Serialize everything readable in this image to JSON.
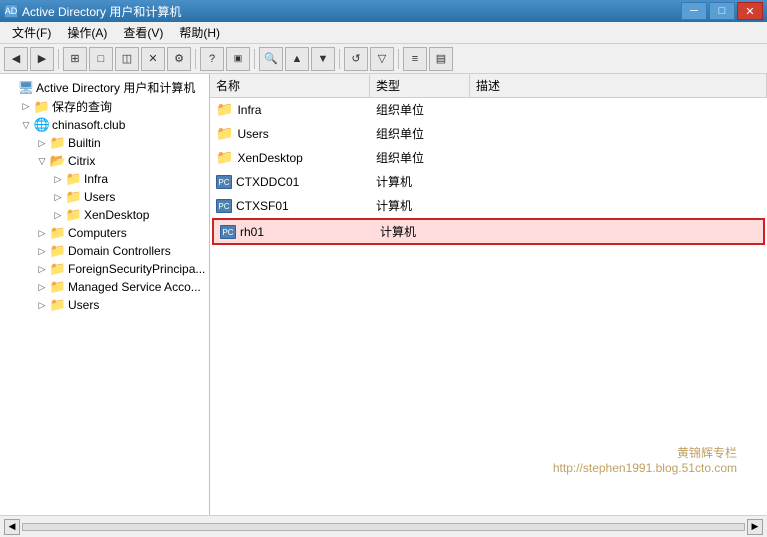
{
  "titleBar": {
    "title": "Active Directory 用户和计算机",
    "minBtn": "─",
    "maxBtn": "□",
    "closeBtn": "✕",
    "iconLabel": "AD"
  },
  "menuBar": {
    "items": [
      {
        "label": "文件(F)"
      },
      {
        "label": "操作(A)"
      },
      {
        "label": "查看(V)"
      },
      {
        "label": "帮助(H)"
      }
    ]
  },
  "toolbar": {
    "buttons": [
      {
        "label": "◀",
        "name": "back-btn"
      },
      {
        "label": "▶",
        "name": "forward-btn"
      },
      {
        "label": "↑",
        "name": "up-btn"
      },
      {
        "label": "⊞",
        "name": "view-btn"
      },
      {
        "label": "□",
        "name": "copy-btn"
      },
      {
        "label": "◫",
        "name": "paste-btn"
      },
      {
        "label": "✕",
        "name": "delete-btn"
      },
      {
        "label": "⚙",
        "name": "prop-btn"
      },
      {
        "sep": true
      },
      {
        "label": "?",
        "name": "help-btn"
      },
      {
        "label": "▣",
        "name": "domain-btn"
      },
      {
        "sep": true
      },
      {
        "label": "🔍",
        "name": "search-btn"
      },
      {
        "label": "▲",
        "name": "move-up-btn"
      },
      {
        "label": "▼",
        "name": "move-down-btn"
      },
      {
        "sep": true
      },
      {
        "label": "🔃",
        "name": "refresh-btn"
      },
      {
        "label": "≡",
        "name": "filter-btn"
      },
      {
        "sep": true
      },
      {
        "label": "▤",
        "name": "list1-btn"
      },
      {
        "label": "◫",
        "name": "list2-btn"
      }
    ]
  },
  "tree": {
    "items": [
      {
        "id": "root",
        "label": "Active Directory 用户和计算机",
        "indent": 0,
        "type": "root",
        "expanded": true,
        "toggle": ""
      },
      {
        "id": "saved",
        "label": "保存的查询",
        "indent": 1,
        "type": "folder",
        "expanded": false,
        "toggle": "▷"
      },
      {
        "id": "domain",
        "label": "chinasoft.club",
        "indent": 1,
        "type": "domain",
        "expanded": true,
        "toggle": "▽"
      },
      {
        "id": "builtin",
        "label": "Builtin",
        "indent": 2,
        "type": "folder",
        "expanded": false,
        "toggle": "▷"
      },
      {
        "id": "citrix",
        "label": "Citrix",
        "indent": 2,
        "type": "folder",
        "expanded": true,
        "toggle": "▽"
      },
      {
        "id": "infra",
        "label": "Infra",
        "indent": 3,
        "type": "ou",
        "expanded": false,
        "toggle": "▷"
      },
      {
        "id": "users",
        "label": "Users",
        "indent": 3,
        "type": "ou",
        "expanded": false,
        "toggle": "▷"
      },
      {
        "id": "xendesktop",
        "label": "XenDesktop",
        "indent": 3,
        "type": "ou",
        "expanded": false,
        "toggle": "▷"
      },
      {
        "id": "computers",
        "label": "Computers",
        "indent": 2,
        "type": "folder",
        "expanded": false,
        "toggle": "▷",
        "selected": false
      },
      {
        "id": "domainControllers",
        "label": "Domain Controllers",
        "indent": 2,
        "type": "folder",
        "expanded": false,
        "toggle": "▷"
      },
      {
        "id": "foreignSecurity",
        "label": "ForeignSecurityPrincipa...",
        "indent": 2,
        "type": "folder",
        "expanded": false,
        "toggle": "▷"
      },
      {
        "id": "managedService",
        "label": "Managed Service Acco...",
        "indent": 2,
        "type": "folder",
        "expanded": false,
        "toggle": "▷"
      },
      {
        "id": "usersRoot",
        "label": "Users",
        "indent": 2,
        "type": "folder",
        "expanded": false,
        "toggle": "▷"
      }
    ]
  },
  "listView": {
    "columns": [
      {
        "label": "名称",
        "key": "name"
      },
      {
        "label": "类型",
        "key": "type"
      },
      {
        "label": "描述",
        "key": "desc"
      }
    ],
    "rows": [
      {
        "name": "Infra",
        "type": "组织单位",
        "desc": "",
        "iconType": "ou",
        "selected": false
      },
      {
        "name": "Users",
        "type": "组织单位",
        "desc": "",
        "iconType": "ou",
        "selected": false
      },
      {
        "name": "XenDesktop",
        "type": "组织单位",
        "desc": "",
        "iconType": "ou",
        "selected": false
      },
      {
        "name": "CTXDDC01",
        "type": "计算机",
        "desc": "",
        "iconType": "computer",
        "selected": false
      },
      {
        "name": "CTXSF01",
        "type": "计算机",
        "desc": "",
        "iconType": "computer",
        "selected": false
      },
      {
        "name": "rh01",
        "type": "计算机",
        "desc": "",
        "iconType": "computer",
        "selected": true
      }
    ]
  },
  "watermark": {
    "line1": "黄锦辉专栏",
    "line2": "http://stephen1991.blog.51cto.com"
  },
  "statusBar": {
    "text": ""
  }
}
